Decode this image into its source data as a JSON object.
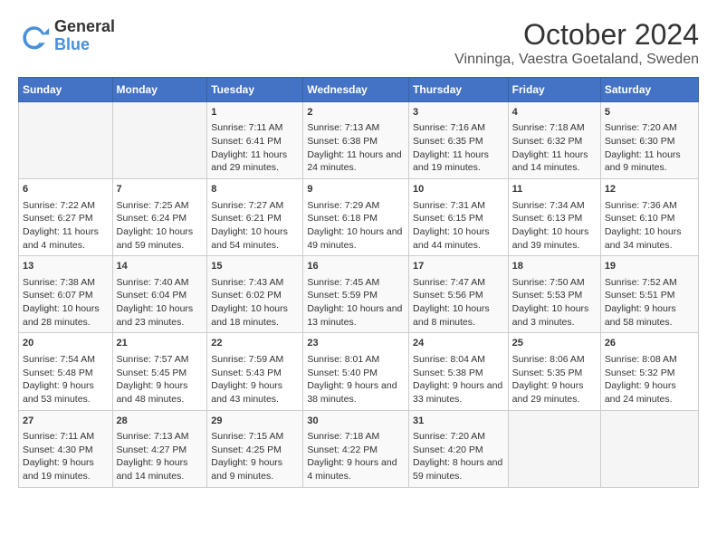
{
  "header": {
    "logo": {
      "general": "General",
      "blue": "Blue"
    },
    "title": "October 2024",
    "subtitle": "Vinninga, Vaestra Goetaland, Sweden"
  },
  "weekdays": [
    "Sunday",
    "Monday",
    "Tuesday",
    "Wednesday",
    "Thursday",
    "Friday",
    "Saturday"
  ],
  "weeks": [
    [
      {
        "day": "",
        "info": ""
      },
      {
        "day": "",
        "info": ""
      },
      {
        "day": "1",
        "info": "Sunrise: 7:11 AM\nSunset: 6:41 PM\nDaylight: 11 hours and 29 minutes."
      },
      {
        "day": "2",
        "info": "Sunrise: 7:13 AM\nSunset: 6:38 PM\nDaylight: 11 hours and 24 minutes."
      },
      {
        "day": "3",
        "info": "Sunrise: 7:16 AM\nSunset: 6:35 PM\nDaylight: 11 hours and 19 minutes."
      },
      {
        "day": "4",
        "info": "Sunrise: 7:18 AM\nSunset: 6:32 PM\nDaylight: 11 hours and 14 minutes."
      },
      {
        "day": "5",
        "info": "Sunrise: 7:20 AM\nSunset: 6:30 PM\nDaylight: 11 hours and 9 minutes."
      }
    ],
    [
      {
        "day": "6",
        "info": "Sunrise: 7:22 AM\nSunset: 6:27 PM\nDaylight: 11 hours and 4 minutes."
      },
      {
        "day": "7",
        "info": "Sunrise: 7:25 AM\nSunset: 6:24 PM\nDaylight: 10 hours and 59 minutes."
      },
      {
        "day": "8",
        "info": "Sunrise: 7:27 AM\nSunset: 6:21 PM\nDaylight: 10 hours and 54 minutes."
      },
      {
        "day": "9",
        "info": "Sunrise: 7:29 AM\nSunset: 6:18 PM\nDaylight: 10 hours and 49 minutes."
      },
      {
        "day": "10",
        "info": "Sunrise: 7:31 AM\nSunset: 6:15 PM\nDaylight: 10 hours and 44 minutes."
      },
      {
        "day": "11",
        "info": "Sunrise: 7:34 AM\nSunset: 6:13 PM\nDaylight: 10 hours and 39 minutes."
      },
      {
        "day": "12",
        "info": "Sunrise: 7:36 AM\nSunset: 6:10 PM\nDaylight: 10 hours and 34 minutes."
      }
    ],
    [
      {
        "day": "13",
        "info": "Sunrise: 7:38 AM\nSunset: 6:07 PM\nDaylight: 10 hours and 28 minutes."
      },
      {
        "day": "14",
        "info": "Sunrise: 7:40 AM\nSunset: 6:04 PM\nDaylight: 10 hours and 23 minutes."
      },
      {
        "day": "15",
        "info": "Sunrise: 7:43 AM\nSunset: 6:02 PM\nDaylight: 10 hours and 18 minutes."
      },
      {
        "day": "16",
        "info": "Sunrise: 7:45 AM\nSunset: 5:59 PM\nDaylight: 10 hours and 13 minutes."
      },
      {
        "day": "17",
        "info": "Sunrise: 7:47 AM\nSunset: 5:56 PM\nDaylight: 10 hours and 8 minutes."
      },
      {
        "day": "18",
        "info": "Sunrise: 7:50 AM\nSunset: 5:53 PM\nDaylight: 10 hours and 3 minutes."
      },
      {
        "day": "19",
        "info": "Sunrise: 7:52 AM\nSunset: 5:51 PM\nDaylight: 9 hours and 58 minutes."
      }
    ],
    [
      {
        "day": "20",
        "info": "Sunrise: 7:54 AM\nSunset: 5:48 PM\nDaylight: 9 hours and 53 minutes."
      },
      {
        "day": "21",
        "info": "Sunrise: 7:57 AM\nSunset: 5:45 PM\nDaylight: 9 hours and 48 minutes."
      },
      {
        "day": "22",
        "info": "Sunrise: 7:59 AM\nSunset: 5:43 PM\nDaylight: 9 hours and 43 minutes."
      },
      {
        "day": "23",
        "info": "Sunrise: 8:01 AM\nSunset: 5:40 PM\nDaylight: 9 hours and 38 minutes."
      },
      {
        "day": "24",
        "info": "Sunrise: 8:04 AM\nSunset: 5:38 PM\nDaylight: 9 hours and 33 minutes."
      },
      {
        "day": "25",
        "info": "Sunrise: 8:06 AM\nSunset: 5:35 PM\nDaylight: 9 hours and 29 minutes."
      },
      {
        "day": "26",
        "info": "Sunrise: 8:08 AM\nSunset: 5:32 PM\nDaylight: 9 hours and 24 minutes."
      }
    ],
    [
      {
        "day": "27",
        "info": "Sunrise: 7:11 AM\nSunset: 4:30 PM\nDaylight: 9 hours and 19 minutes."
      },
      {
        "day": "28",
        "info": "Sunrise: 7:13 AM\nSunset: 4:27 PM\nDaylight: 9 hours and 14 minutes."
      },
      {
        "day": "29",
        "info": "Sunrise: 7:15 AM\nSunset: 4:25 PM\nDaylight: 9 hours and 9 minutes."
      },
      {
        "day": "30",
        "info": "Sunrise: 7:18 AM\nSunset: 4:22 PM\nDaylight: 9 hours and 4 minutes."
      },
      {
        "day": "31",
        "info": "Sunrise: 7:20 AM\nSunset: 4:20 PM\nDaylight: 8 hours and 59 minutes."
      },
      {
        "day": "",
        "info": ""
      },
      {
        "day": "",
        "info": ""
      }
    ]
  ]
}
